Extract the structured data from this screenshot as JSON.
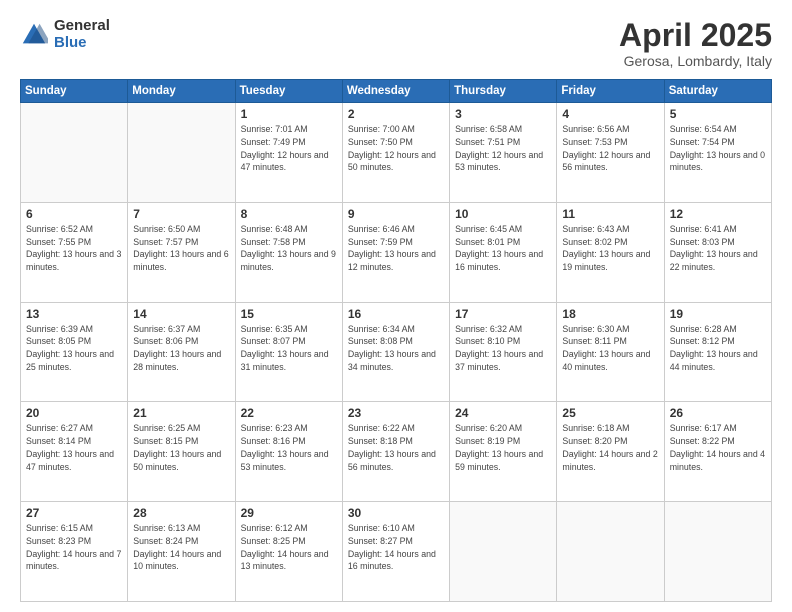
{
  "logo": {
    "general": "General",
    "blue": "Blue"
  },
  "title": {
    "month": "April 2025",
    "location": "Gerosa, Lombardy, Italy"
  },
  "days": [
    "Sunday",
    "Monday",
    "Tuesday",
    "Wednesday",
    "Thursday",
    "Friday",
    "Saturday"
  ],
  "weeks": [
    [
      {
        "day": "",
        "info": ""
      },
      {
        "day": "",
        "info": ""
      },
      {
        "day": "1",
        "info": "Sunrise: 7:01 AM\nSunset: 7:49 PM\nDaylight: 12 hours\nand 47 minutes."
      },
      {
        "day": "2",
        "info": "Sunrise: 7:00 AM\nSunset: 7:50 PM\nDaylight: 12 hours\nand 50 minutes."
      },
      {
        "day": "3",
        "info": "Sunrise: 6:58 AM\nSunset: 7:51 PM\nDaylight: 12 hours\nand 53 minutes."
      },
      {
        "day": "4",
        "info": "Sunrise: 6:56 AM\nSunset: 7:53 PM\nDaylight: 12 hours\nand 56 minutes."
      },
      {
        "day": "5",
        "info": "Sunrise: 6:54 AM\nSunset: 7:54 PM\nDaylight: 13 hours\nand 0 minutes."
      }
    ],
    [
      {
        "day": "6",
        "info": "Sunrise: 6:52 AM\nSunset: 7:55 PM\nDaylight: 13 hours\nand 3 minutes."
      },
      {
        "day": "7",
        "info": "Sunrise: 6:50 AM\nSunset: 7:57 PM\nDaylight: 13 hours\nand 6 minutes."
      },
      {
        "day": "8",
        "info": "Sunrise: 6:48 AM\nSunset: 7:58 PM\nDaylight: 13 hours\nand 9 minutes."
      },
      {
        "day": "9",
        "info": "Sunrise: 6:46 AM\nSunset: 7:59 PM\nDaylight: 13 hours\nand 12 minutes."
      },
      {
        "day": "10",
        "info": "Sunrise: 6:45 AM\nSunset: 8:01 PM\nDaylight: 13 hours\nand 16 minutes."
      },
      {
        "day": "11",
        "info": "Sunrise: 6:43 AM\nSunset: 8:02 PM\nDaylight: 13 hours\nand 19 minutes."
      },
      {
        "day": "12",
        "info": "Sunrise: 6:41 AM\nSunset: 8:03 PM\nDaylight: 13 hours\nand 22 minutes."
      }
    ],
    [
      {
        "day": "13",
        "info": "Sunrise: 6:39 AM\nSunset: 8:05 PM\nDaylight: 13 hours\nand 25 minutes."
      },
      {
        "day": "14",
        "info": "Sunrise: 6:37 AM\nSunset: 8:06 PM\nDaylight: 13 hours\nand 28 minutes."
      },
      {
        "day": "15",
        "info": "Sunrise: 6:35 AM\nSunset: 8:07 PM\nDaylight: 13 hours\nand 31 minutes."
      },
      {
        "day": "16",
        "info": "Sunrise: 6:34 AM\nSunset: 8:08 PM\nDaylight: 13 hours\nand 34 minutes."
      },
      {
        "day": "17",
        "info": "Sunrise: 6:32 AM\nSunset: 8:10 PM\nDaylight: 13 hours\nand 37 minutes."
      },
      {
        "day": "18",
        "info": "Sunrise: 6:30 AM\nSunset: 8:11 PM\nDaylight: 13 hours\nand 40 minutes."
      },
      {
        "day": "19",
        "info": "Sunrise: 6:28 AM\nSunset: 8:12 PM\nDaylight: 13 hours\nand 44 minutes."
      }
    ],
    [
      {
        "day": "20",
        "info": "Sunrise: 6:27 AM\nSunset: 8:14 PM\nDaylight: 13 hours\nand 47 minutes."
      },
      {
        "day": "21",
        "info": "Sunrise: 6:25 AM\nSunset: 8:15 PM\nDaylight: 13 hours\nand 50 minutes."
      },
      {
        "day": "22",
        "info": "Sunrise: 6:23 AM\nSunset: 8:16 PM\nDaylight: 13 hours\nand 53 minutes."
      },
      {
        "day": "23",
        "info": "Sunrise: 6:22 AM\nSunset: 8:18 PM\nDaylight: 13 hours\nand 56 minutes."
      },
      {
        "day": "24",
        "info": "Sunrise: 6:20 AM\nSunset: 8:19 PM\nDaylight: 13 hours\nand 59 minutes."
      },
      {
        "day": "25",
        "info": "Sunrise: 6:18 AM\nSunset: 8:20 PM\nDaylight: 14 hours\nand 2 minutes."
      },
      {
        "day": "26",
        "info": "Sunrise: 6:17 AM\nSunset: 8:22 PM\nDaylight: 14 hours\nand 4 minutes."
      }
    ],
    [
      {
        "day": "27",
        "info": "Sunrise: 6:15 AM\nSunset: 8:23 PM\nDaylight: 14 hours\nand 7 minutes."
      },
      {
        "day": "28",
        "info": "Sunrise: 6:13 AM\nSunset: 8:24 PM\nDaylight: 14 hours\nand 10 minutes."
      },
      {
        "day": "29",
        "info": "Sunrise: 6:12 AM\nSunset: 8:25 PM\nDaylight: 14 hours\nand 13 minutes."
      },
      {
        "day": "30",
        "info": "Sunrise: 6:10 AM\nSunset: 8:27 PM\nDaylight: 14 hours\nand 16 minutes."
      },
      {
        "day": "",
        "info": ""
      },
      {
        "day": "",
        "info": ""
      },
      {
        "day": "",
        "info": ""
      }
    ]
  ]
}
